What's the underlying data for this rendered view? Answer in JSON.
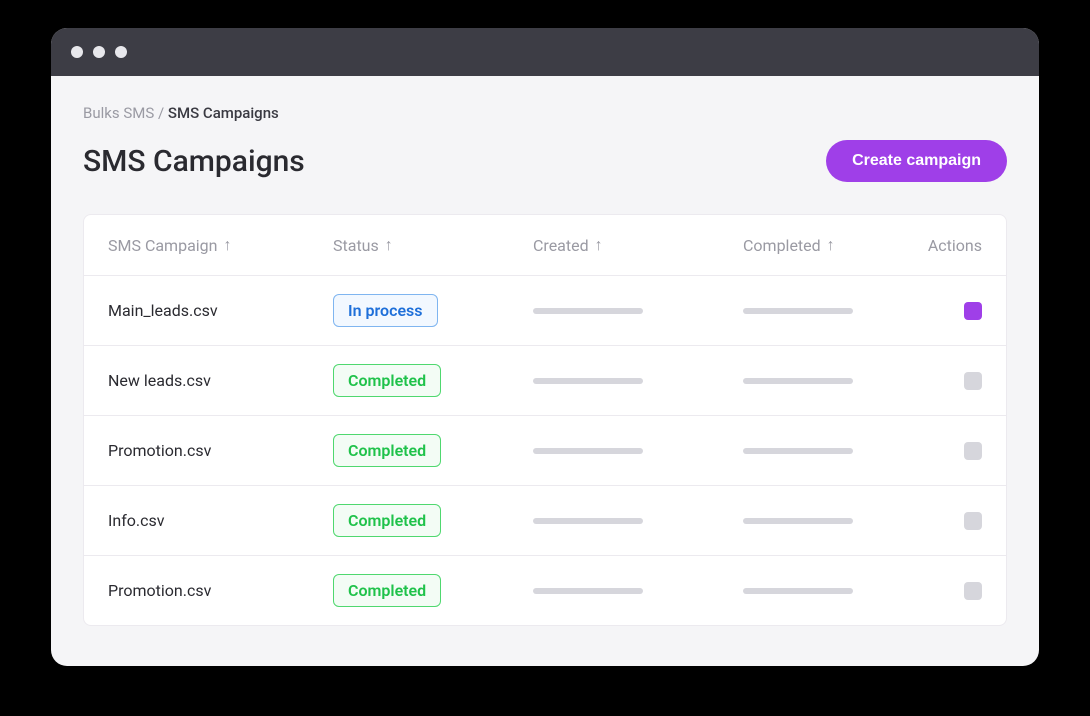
{
  "breadcrumb": {
    "parent": "Bulks SMS",
    "separator": " / ",
    "current": "SMS Campaigns"
  },
  "page": {
    "title": "SMS Campaigns",
    "create_button_label": "Create campaign"
  },
  "table": {
    "headers": {
      "name": "SMS Campaign",
      "status": "Status",
      "created": "Created",
      "completed": "Completed",
      "actions": "Actions"
    },
    "rows": [
      {
        "name": "Main_leads.csv",
        "status": "In process",
        "status_type": "inprocess",
        "active": true
      },
      {
        "name": "New leads.csv",
        "status": "Completed",
        "status_type": "completed",
        "active": false
      },
      {
        "name": "Promotion.csv",
        "status": "Completed",
        "status_type": "completed",
        "active": false
      },
      {
        "name": "Info.csv",
        "status": "Completed",
        "status_type": "completed",
        "active": false
      },
      {
        "name": "Promotion.csv",
        "status": "Completed",
        "status_type": "completed",
        "active": false
      }
    ]
  }
}
